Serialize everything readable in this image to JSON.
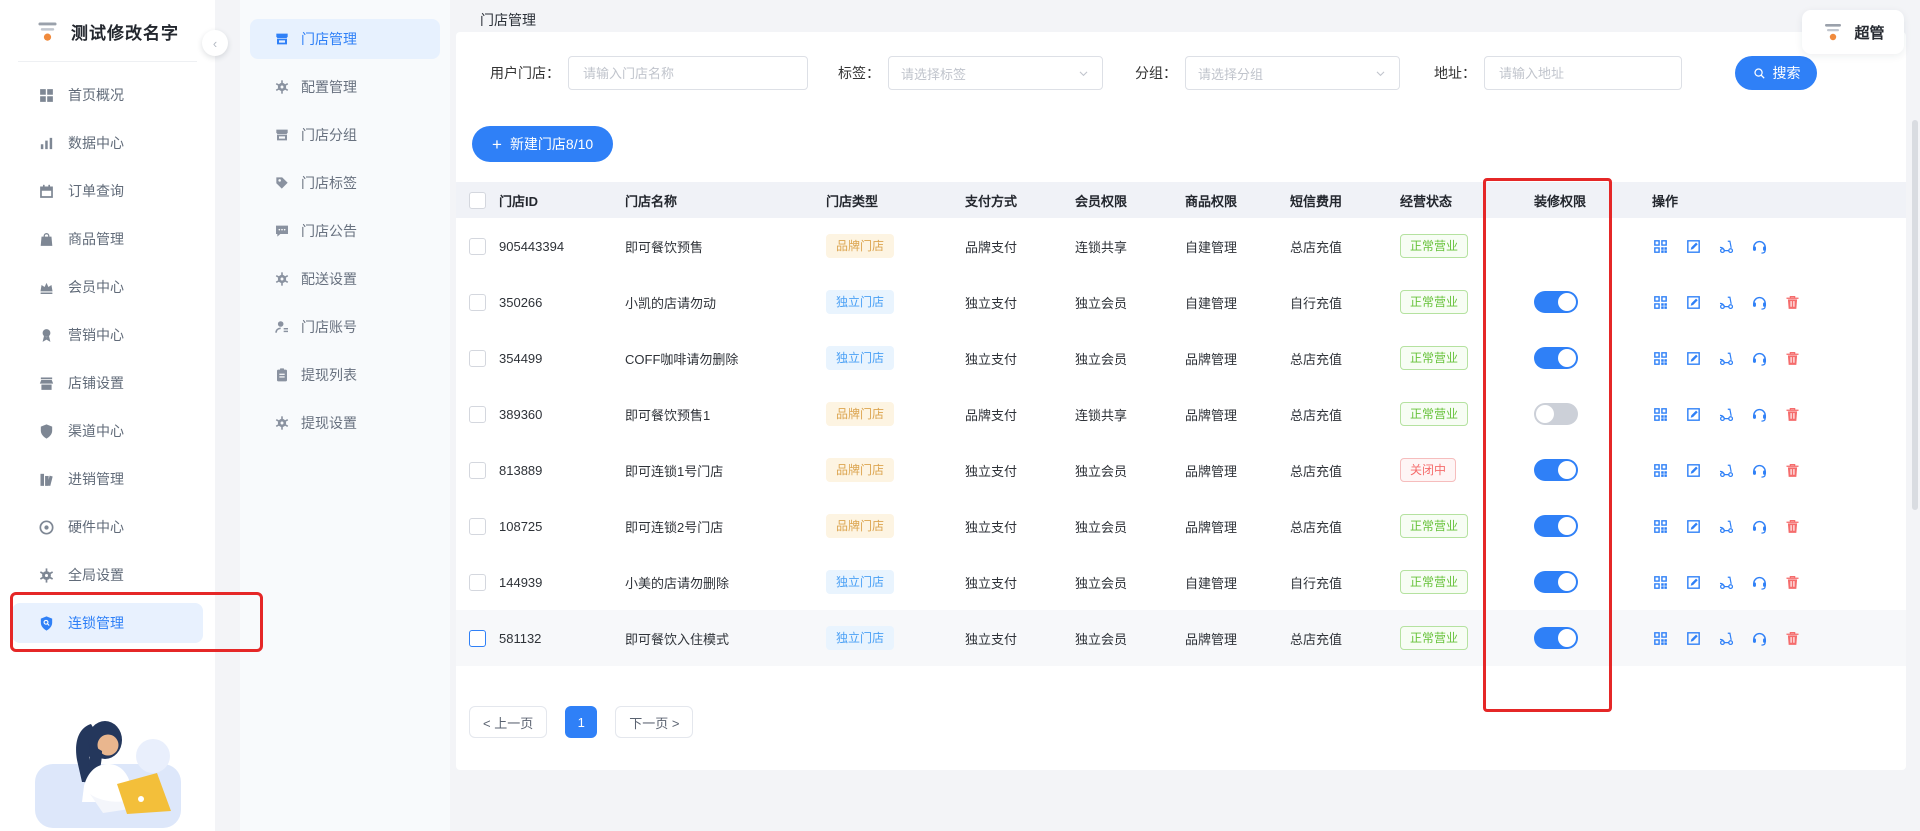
{
  "app_title": "测试修改名字",
  "user": {
    "label": "超管"
  },
  "sidebar": {
    "items": [
      {
        "label": "首页概况",
        "icon": "i-grid"
      },
      {
        "label": "数据中心",
        "icon": "i-chart"
      },
      {
        "label": "订单查询",
        "icon": "i-calendar"
      },
      {
        "label": "商品管理",
        "icon": "i-bag"
      },
      {
        "label": "会员中心",
        "icon": "i-crown"
      },
      {
        "label": "营销中心",
        "icon": "i-medal"
      },
      {
        "label": "店铺设置",
        "icon": "i-shop"
      },
      {
        "label": "渠道中心",
        "icon": "i-shield"
      },
      {
        "label": "进销管理",
        "icon": "i-books"
      },
      {
        "label": "硬件中心",
        "icon": "i-disc"
      },
      {
        "label": "全局设置",
        "icon": "i-gear"
      },
      {
        "label": "连锁管理",
        "icon": "i-shield-search",
        "active": true
      }
    ]
  },
  "submenu": {
    "items": [
      {
        "label": "门店管理",
        "icon": "i-store",
        "active": true
      },
      {
        "label": "配置管理",
        "icon": "i-gear"
      },
      {
        "label": "门店分组",
        "icon": "i-store"
      },
      {
        "label": "门店标签",
        "icon": "i-tag"
      },
      {
        "label": "门店公告",
        "icon": "i-comment"
      },
      {
        "label": "配送设置",
        "icon": "i-gear"
      },
      {
        "label": "门店账号",
        "icon": "i-user"
      },
      {
        "label": "提现列表",
        "icon": "i-clipboard"
      },
      {
        "label": "提现设置",
        "icon": "i-gear"
      }
    ]
  },
  "breadcrumb": "门店管理",
  "filters": {
    "store_label": "用户门店：",
    "store_placeholder": "请输入门店名称",
    "tag_label": "标签：",
    "tag_placeholder": "请选择标签",
    "group_label": "分组：",
    "group_placeholder": "请选择分组",
    "address_label": "地址：",
    "address_placeholder": "请输入地址",
    "search_label": "搜索"
  },
  "toolbar": {
    "plus": "+",
    "new_store_label": "新建门店8/10"
  },
  "table": {
    "headers": {
      "id": "门店ID",
      "name": "门店名称",
      "type": "门店类型",
      "pay": "支付方式",
      "member": "会员权限",
      "product": "商品权限",
      "sms": "短信费用",
      "status": "经营状态",
      "renovation": "装修权限",
      "ops": "操作"
    },
    "rows": [
      {
        "id": "905443394",
        "name": "即可餐饮预售",
        "type": "品牌门店",
        "type_style": "brand",
        "pay": "品牌支付",
        "member": "连锁共享",
        "product": "自建管理",
        "sms": "总店充值",
        "status": "正常营业",
        "status_style": "open",
        "renovation": "none",
        "deletable": false,
        "highlighted": false
      },
      {
        "id": "350266",
        "name": "小凯的店请勿动",
        "type": "独立门店",
        "type_style": "indep",
        "pay": "独立支付",
        "member": "独立会员",
        "product": "自建管理",
        "sms": "自行充值",
        "status": "正常营业",
        "status_style": "open",
        "renovation": "on",
        "deletable": true,
        "highlighted": false
      },
      {
        "id": "354499",
        "name": "COFF咖啡请勿删除",
        "type": "独立门店",
        "type_style": "indep",
        "pay": "独立支付",
        "member": "独立会员",
        "product": "品牌管理",
        "sms": "总店充值",
        "status": "正常营业",
        "status_style": "open",
        "renovation": "on",
        "deletable": true,
        "highlighted": false
      },
      {
        "id": "389360",
        "name": "即可餐饮预售1",
        "type": "品牌门店",
        "type_style": "brand",
        "pay": "品牌支付",
        "member": "连锁共享",
        "product": "品牌管理",
        "sms": "总店充值",
        "status": "正常营业",
        "status_style": "open",
        "renovation": "off",
        "deletable": true,
        "highlighted": false
      },
      {
        "id": "813889",
        "name": "即可连锁1号门店",
        "type": "品牌门店",
        "type_style": "brand",
        "pay": "独立支付",
        "member": "独立会员",
        "product": "品牌管理",
        "sms": "总店充值",
        "status": "关闭中",
        "status_style": "closed",
        "renovation": "on",
        "deletable": true,
        "highlighted": false
      },
      {
        "id": "108725",
        "name": "即可连锁2号门店",
        "type": "品牌门店",
        "type_style": "brand",
        "pay": "独立支付",
        "member": "独立会员",
        "product": "品牌管理",
        "sms": "总店充值",
        "status": "正常营业",
        "status_style": "open",
        "renovation": "on",
        "deletable": true,
        "highlighted": false
      },
      {
        "id": "144939",
        "name": "小美的店请勿删除",
        "type": "独立门店",
        "type_style": "indep",
        "pay": "独立支付",
        "member": "独立会员",
        "product": "自建管理",
        "sms": "自行充值",
        "status": "正常营业",
        "status_style": "open",
        "renovation": "on",
        "deletable": true,
        "highlighted": false
      },
      {
        "id": "581132",
        "name": "即可餐饮入住模式",
        "type": "独立门店",
        "type_style": "indep",
        "pay": "独立支付",
        "member": "独立会员",
        "product": "品牌管理",
        "sms": "总店充值",
        "status": "正常营业",
        "status_style": "open",
        "renovation": "on",
        "deletable": true,
        "highlighted": true
      }
    ]
  },
  "pagination": {
    "prev": "< 上一页",
    "current": "1",
    "next": "下一页 >"
  },
  "colors": {
    "primary": "#2f80f7",
    "annotation": "#e52727",
    "brand_tag_text": "#dca550",
    "indep_tag_text": "#4aa0f5",
    "status_open": "#67c23a",
    "status_closed": "#f56c6c"
  }
}
